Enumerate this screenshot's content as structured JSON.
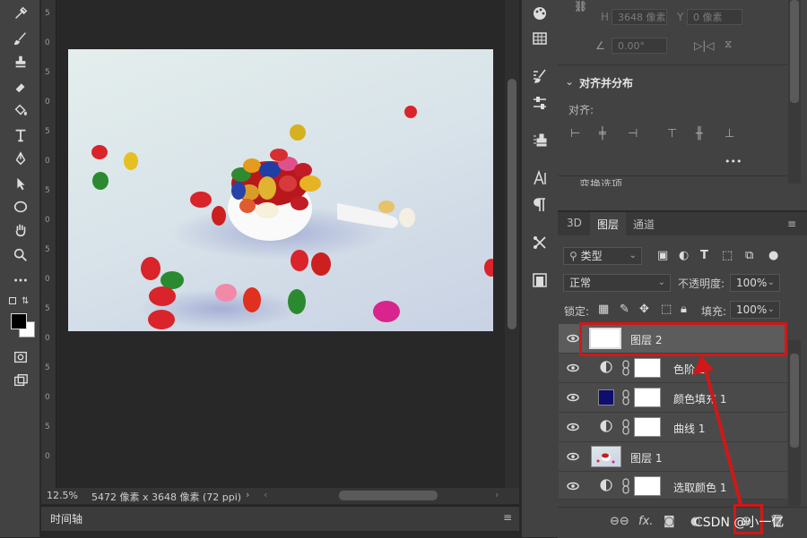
{
  "tools": [
    "eyedropper-icon",
    "brush-icon",
    "clone-stamp-icon",
    "eraser-icon",
    "paint-bucket-icon",
    "type-icon",
    "pen-icon",
    "path-select-icon",
    "ellipse-icon",
    "hand-icon",
    "zoom-icon",
    "more-tools-icon"
  ],
  "ruler": {
    "numbers": [
      "5",
      "0",
      "5",
      "0",
      "5",
      "0",
      "5",
      "0",
      "5",
      "0",
      "5",
      "0",
      "5",
      "0",
      "5",
      "0"
    ]
  },
  "status": {
    "zoom": "12.5%",
    "doc_info": "5472 像素 x 3648 像素 (72 ppi)"
  },
  "timeline": {
    "label": "时间轴"
  },
  "properties": {
    "h_label": "H",
    "h_value": "3648 像素",
    "y_label": "Y",
    "y_value": "0 像素",
    "angle_value": "0.00°",
    "align_section": "对齐并分布",
    "align_label": "对齐:",
    "more": "•••",
    "collapsed_partial": "变换选项"
  },
  "layers_panel": {
    "tabs": [
      "3D",
      "图层",
      "通道"
    ],
    "filter_kind": "类型",
    "blend_mode": "正常",
    "opacity_label": "不透明度:",
    "opacity_value": "100%",
    "lock_label": "锁定:",
    "fill_label": "填充:",
    "fill_value": "100%",
    "layers": [
      {
        "name": "图层 2",
        "type": "pixel-white",
        "selected": true
      },
      {
        "name": "色阶 2",
        "type": "adjustment"
      },
      {
        "name": "颜色填充 1",
        "type": "fill",
        "color": "#0e0e6e"
      },
      {
        "name": "曲线 1",
        "type": "adjustment"
      },
      {
        "name": "图层 1",
        "type": "photo"
      },
      {
        "name": "选取颜色 1",
        "type": "adjustment"
      }
    ]
  },
  "watermark": "CSDN @小一亿",
  "colors": {
    "highlight_red": "#d01818",
    "fill_swatch": "#0e0e6e"
  }
}
